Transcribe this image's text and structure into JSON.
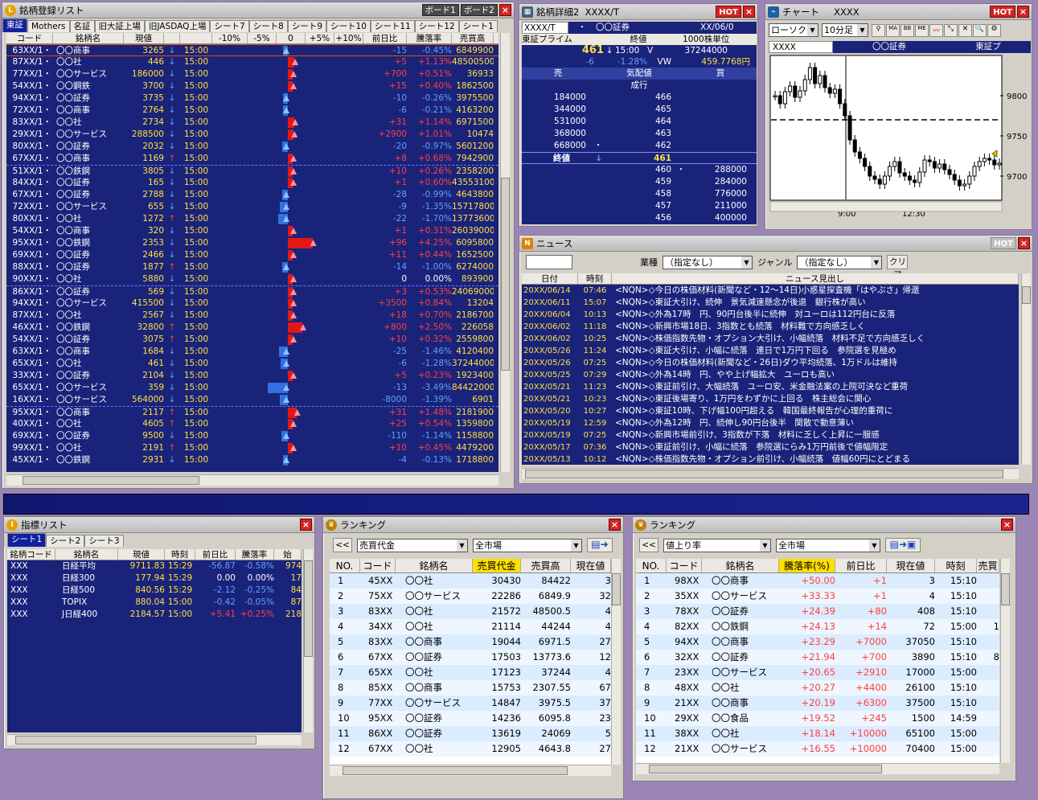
{
  "stocklist": {
    "title": "銘柄登録リスト",
    "board1": "ボード1",
    "board2": "ボード2",
    "tabs": [
      "東証",
      "Mothers",
      "名証",
      "旧大証上場",
      "旧JASDAQ上場",
      "シート7",
      "シート8",
      "シート9",
      "シート10",
      "シート11",
      "シート12",
      "シート1"
    ],
    "cols": [
      "コード",
      "銘柄名",
      "現値",
      "",
      "",
      "-10%",
      "-5%",
      "0",
      "+5%",
      "+10%",
      "前日比",
      "騰落率",
      "売買高"
    ],
    "rows": [
      [
        "63XX/1・",
        "〇〇商事",
        "3265",
        "↓",
        "15:00",
        "-15",
        "-0.45%",
        "6849900",
        -0.45
      ],
      [
        "87XX/1・",
        "〇〇社",
        "446",
        "↓",
        "15:00",
        "+5",
        "+1.13%",
        "48500500",
        1.13
      ],
      [
        "77XX/1・",
        "〇〇サービス",
        "186000",
        "↓",
        "15:00",
        "+700",
        "+0.51%",
        "36933",
        0.51
      ],
      [
        "54XX/1・",
        "〇〇鋼鉄",
        "3700",
        "↓",
        "15:00",
        "+15",
        "+0.40%",
        "1862500",
        0.4
      ],
      [
        "94XX/1・",
        "〇〇証券",
        "3735",
        "↓",
        "15:00",
        "-10",
        "-0.26%",
        "3975500",
        -0.26
      ],
      [
        "72XX/1・",
        "〇〇商事",
        "2764",
        "↓",
        "15:00",
        "-6",
        "-0.21%",
        "4163200",
        -0.21
      ],
      [
        "83XX/1・",
        "〇〇社",
        "2734",
        "↓",
        "15:00",
        "+31",
        "+1.14%",
        "6971500",
        1.14
      ],
      [
        "29XX/1・",
        "〇〇サービス",
        "288500",
        "↓",
        "15:00",
        "+2900",
        "+1.01%",
        "10474",
        1.01
      ],
      [
        "80XX/1・",
        "〇〇証券",
        "2032",
        "↓",
        "15:00",
        "-20",
        "-0.97%",
        "5601200",
        -0.97
      ],
      [
        "67XX/1・",
        "〇〇商事",
        "1169",
        "↑",
        "15:00",
        "+8",
        "+0.68%",
        "7942900",
        0.68
      ],
      [
        "51XX/1・",
        "〇〇鉄鋼",
        "3805",
        "↓",
        "15:00",
        "+10",
        "+0.26%",
        "2358200",
        0.26
      ],
      [
        "84XX/1・",
        "〇〇証券",
        "165",
        "↓",
        "15:00",
        "+1",
        "+0.60%",
        "43553100",
        0.6
      ],
      [
        "67XX/1・",
        "〇〇証券",
        "2788",
        "↓",
        "15:00",
        "-28",
        "-0.99%",
        "4643800",
        -0.99
      ],
      [
        "72XX/1・",
        "〇〇サービス",
        "655",
        "↓",
        "15:00",
        "-9",
        "-1.35%",
        "15717800",
        -1.35
      ],
      [
        "80XX/1・",
        "〇〇社",
        "1272",
        "↑",
        "15:00",
        "-22",
        "-1.70%",
        "13773600",
        -1.7
      ],
      [
        "54XX/1・",
        "〇〇商事",
        "320",
        "↓",
        "15:00",
        "+1",
        "+0.31%",
        "26039000",
        0.31
      ],
      [
        "95XX/1・",
        "〇〇鉄鋼",
        "2353",
        "↓",
        "15:00",
        "+96",
        "+4.25%",
        "6095800",
        4.25
      ],
      [
        "69XX/1・",
        "〇〇証券",
        "2466",
        "↓",
        "15:00",
        "+11",
        "+0.44%",
        "1652500",
        0.44
      ],
      [
        "88XX/1・",
        "〇〇証券",
        "1877",
        "↑",
        "15:00",
        "-14",
        "-1.00%",
        "6274000",
        -1.0
      ],
      [
        "90XX/1・",
        "〇〇社",
        "5880",
        "↓",
        "15:00",
        "0",
        "0.00%",
        "893900",
        0
      ],
      [
        "86XX/1・",
        "〇〇証券",
        "569",
        "↓",
        "15:00",
        "+3",
        "+0.53%",
        "24069000",
        0.53
      ],
      [
        "94XX/1・",
        "〇〇サービス",
        "415500",
        "↓",
        "15:00",
        "+3500",
        "+0.84%",
        "13204",
        0.84
      ],
      [
        "87XX/1・",
        "〇〇社",
        "2567",
        "↓",
        "15:00",
        "+18",
        "+0.70%",
        "2186700",
        0.7
      ],
      [
        "46XX/1・",
        "〇〇鉄鋼",
        "32800",
        "↑",
        "15:00",
        "+800",
        "+2.50%",
        "226058",
        2.5
      ],
      [
        "54XX/1・",
        "〇〇証券",
        "3075",
        "↑",
        "15:00",
        "+10",
        "+0.32%",
        "2559800",
        0.32
      ],
      [
        "63XX/1・",
        "〇〇商事",
        "1684",
        "↓",
        "15:00",
        "-25",
        "-1.46%",
        "4120400",
        -1.46
      ],
      [
        "65XX/1・",
        "〇〇社",
        "461",
        "↓",
        "15:00",
        "-6",
        "-1.28%",
        "37244000",
        -1.28
      ],
      [
        "33XX/1・",
        "〇〇証券",
        "2104",
        "↓",
        "15:00",
        "+5",
        "+0.23%",
        "1923400",
        0.23
      ],
      [
        "65XX/1・",
        "〇〇サービス",
        "359",
        "↓",
        "15:00",
        "-13",
        "-3.49%",
        "84422000",
        -3.49
      ],
      [
        "16XX/1・",
        "〇〇サービス",
        "564000",
        "↓",
        "15:00",
        "-8000",
        "-1.39%",
        "6901",
        -1.39
      ],
      [
        "95XX/1・",
        "〇〇商事",
        "2117",
        "↑",
        "15:00",
        "+31",
        "+1.48%",
        "2181900",
        1.48
      ],
      [
        "40XX/1・",
        "〇〇社",
        "4605",
        "↑",
        "15:00",
        "+25",
        "+0.54%",
        "1359800",
        0.54
      ],
      [
        "69XX/1・",
        "〇〇証券",
        "9500",
        "↓",
        "15:00",
        "-110",
        "-1.14%",
        "1158800",
        -1.14
      ],
      [
        "99XX/1・",
        "〇〇社",
        "2191",
        "↑",
        "15:00",
        "+10",
        "+0.45%",
        "4479200",
        0.45
      ],
      [
        "45XX/1・",
        "〇〇鉄鋼",
        "2931",
        "↓",
        "15:00",
        "-4",
        "-0.13%",
        "1718800",
        -0.13
      ]
    ]
  },
  "detail": {
    "title": "銘柄詳細2",
    "code": "XXXX/T",
    "row1": [
      "XXXX/T",
      "・",
      "〇〇証券",
      "XX/06/0"
    ],
    "market": "東証プライム",
    "close_label": "終値",
    "unit": "1000株単位",
    "price": "461",
    "arrow": "↓",
    "time": "15:00",
    "v_label": "V",
    "volume": "37244000",
    "change": "-6",
    "pct": "-1.28%",
    "vw_label": "VW",
    "vw": "459.7768円",
    "book_hdr": [
      "売",
      "気配値",
      "買"
    ],
    "market_order": "成行",
    "sells": [
      [
        "184000",
        "466"
      ],
      [
        "344000",
        "465"
      ],
      [
        "531000",
        "464"
      ],
      [
        "368000",
        "463"
      ],
      [
        "668000",
        "・",
        "462"
      ]
    ],
    "last": [
      "終値",
      "↓",
      "461"
    ],
    "buys": [
      [
        "460",
        "・",
        "288000"
      ],
      [
        "459",
        "284000"
      ],
      [
        "458",
        "776000"
      ],
      [
        "457",
        "211000"
      ],
      [
        "456",
        "400000"
      ]
    ]
  },
  "chart": {
    "title": "チャート",
    "code": "XXXX",
    "type": "ローソク",
    "interval": "10分足",
    "info": [
      "XXXX",
      "〇〇証券",
      "東証プ"
    ],
    "yticks": [
      "9800",
      "9750",
      "9700"
    ],
    "xticks": [
      "9:00",
      "12:30"
    ],
    "chart_data": {
      "type": "candlestick",
      "x": [
        "9:00",
        "12:30"
      ],
      "ylim": [
        9670,
        9850
      ],
      "yticks": [
        9800,
        9750,
        9700
      ]
    }
  },
  "news": {
    "title": "ニュース",
    "industry_label": "業種",
    "industry": "（指定なし）",
    "genre_label": "ジャンル",
    "genre": "（指定なし）",
    "clear": "クリア",
    "cols": [
      "日付",
      "時刻",
      "ニュース見出し"
    ],
    "rows": [
      [
        "20XX/06/14",
        "07:46",
        "<NQN>◇今日の株価材料(新聞など・12～14日)小惑星探査機「はやぶさ」帰還"
      ],
      [
        "20XX/06/11",
        "15:07",
        "<NQN>◇東証大引け、続伸　景気減速懸念が後退　銀行株が高い"
      ],
      [
        "20XX/06/04",
        "10:13",
        "<NQN>◇外為17時　円、90円台後半に続伸　対ユーロは112円台に反落"
      ],
      [
        "20XX/06/02",
        "11:18",
        "<NQN>◇新興市場18日、3指数とも続落　材料難で方向感乏しく"
      ],
      [
        "20XX/06/02",
        "10:25",
        "<NQN>◇株価指数先物・オプション大引け、小幅続落　材料不足で方向感乏しく"
      ],
      [
        "20XX/05/26",
        "11:24",
        "<NQN>◇東証大引け、小幅に続落　連日で1万円下回る　参院選を見極め"
      ],
      [
        "20XX/05/26",
        "07:25",
        "<NQN>◇今日の株価材料(新聞など・26日)ダウ平均続落、1万ドルは維持"
      ],
      [
        "20XX/05/25",
        "07:29",
        "<NQN>◇外為14時　円、やや上げ幅拡大　ユーロも高い"
      ],
      [
        "20XX/05/21",
        "11:23",
        "<NQN>◇東証前引け、大幅続落　ユーロ安、米金融法案の上院可決など重荷"
      ],
      [
        "20XX/05/21",
        "10:23",
        "<NQN>◇東証後場寄り、1万円をわずかに上回る　株主総会に関心"
      ],
      [
        "20XX/05/20",
        "10:27",
        "<NQN>◇東証10時、下げ幅100円超える　韓国最終報告が心理的重荷に"
      ],
      [
        "20XX/05/19",
        "12:59",
        "<NQN>◇外為12時　円、続伸し90円台後半　関散で動意薄い"
      ],
      [
        "20XX/05/19",
        "07:25",
        "<NQN>◇新興市場前引け、3指数が下落　材料に乏しく上昇に一服感"
      ],
      [
        "20XX/05/17",
        "07:36",
        "<NQN>◇東証前引け、小幅に続落　参院選にらみ1万円前後で値幅限定"
      ],
      [
        "20XX/05/13",
        "10:12",
        "<NQN>◇株価指数先物・オプション前引け、小幅続落　値幅60円にとどまる"
      ]
    ]
  },
  "indices": {
    "title": "指標リスト",
    "tabs": [
      "シート1",
      "シート2",
      "シート3"
    ],
    "cols": [
      "銘柄コード",
      "銘柄名",
      "現値",
      "時刻",
      "前日比",
      "騰落率",
      "始"
    ],
    "rows": [
      [
        "XXX",
        "日経平均",
        "9711.83",
        "15:29",
        "-56.87",
        "-0.58%",
        "974"
      ],
      [
        "XXX",
        "日経300",
        "177.94",
        "15:29",
        "0.00",
        "0.00%",
        "17"
      ],
      [
        "XXX",
        "日経500",
        "840.56",
        "15:29",
        "-2.12",
        "-0.25%",
        "84"
      ],
      [
        "XXX",
        "TOPIX",
        "880.04",
        "15:00",
        "-0.42",
        "-0.05%",
        "87"
      ],
      [
        "XXX",
        "J日経400",
        "2184.57",
        "15:00",
        "+5.41",
        "+0.25%",
        "218"
      ]
    ]
  },
  "rank1": {
    "title": "ランキング",
    "back": "<<",
    "metric": "売買代金",
    "market": "全市場",
    "cols": [
      "NO.",
      "コード",
      "銘柄名",
      "売買代金",
      "売買高",
      "現在値"
    ],
    "rows": [
      [
        "1",
        "45XX",
        "〇〇社",
        "30430",
        "84422",
        "3"
      ],
      [
        "2",
        "75XX",
        "〇〇サービス",
        "22286",
        "6849.9",
        "32"
      ],
      [
        "3",
        "83XX",
        "〇〇社",
        "21572",
        "48500.5",
        "4"
      ],
      [
        "4",
        "34XX",
        "〇〇社",
        "21114",
        "44244",
        "4"
      ],
      [
        "5",
        "83XX",
        "〇〇商事",
        "19044",
        "6971.5",
        "27"
      ],
      [
        "6",
        "67XX",
        "〇〇証券",
        "17503",
        "13773.6",
        "12"
      ],
      [
        "7",
        "65XX",
        "〇〇社",
        "17123",
        "37244",
        "4"
      ],
      [
        "8",
        "85XX",
        "〇〇商事",
        "15753",
        "2307.55",
        "67"
      ],
      [
        "9",
        "77XX",
        "〇〇サービス",
        "14847",
        "3975.5",
        "37"
      ],
      [
        "10",
        "95XX",
        "〇〇証券",
        "14236",
        "6095.8",
        "23"
      ],
      [
        "11",
        "86XX",
        "〇〇証券",
        "13619",
        "24069",
        "5"
      ],
      [
        "12",
        "67XX",
        "〇〇社",
        "12905",
        "4643.8",
        "27"
      ]
    ]
  },
  "rank2": {
    "title": "ランキング",
    "back": "<<",
    "metric": "値上り率",
    "market": "全市場",
    "cols": [
      "NO.",
      "コード",
      "銘柄名",
      "騰落率(%)",
      "前日比",
      "現在値",
      "時刻",
      "売買"
    ],
    "rows": [
      [
        "1",
        "98XX",
        "〇〇商事",
        "+50.00",
        "+1",
        "3",
        "15:10",
        ""
      ],
      [
        "2",
        "35XX",
        "〇〇サービス",
        "+33.33",
        "+1",
        "4",
        "15:10",
        ""
      ],
      [
        "3",
        "78XX",
        "〇〇証券",
        "+24.39",
        "+80",
        "408",
        "15:10",
        ""
      ],
      [
        "4",
        "82XX",
        "〇〇鉄鋼",
        "+24.13",
        "+14",
        "72",
        "15:00",
        "1"
      ],
      [
        "5",
        "94XX",
        "〇〇商事",
        "+23.29",
        "+7000",
        "37050",
        "15:10",
        ""
      ],
      [
        "6",
        "32XX",
        "〇〇証券",
        "+21.94",
        "+700",
        "3890",
        "15:10",
        "8"
      ],
      [
        "7",
        "23XX",
        "〇〇サービス",
        "+20.65",
        "+2910",
        "17000",
        "15:00",
        ""
      ],
      [
        "8",
        "48XX",
        "〇〇社",
        "+20.27",
        "+4400",
        "26100",
        "15:10",
        ""
      ],
      [
        "9",
        "21XX",
        "〇〇商事",
        "+20.19",
        "+6300",
        "37500",
        "15:10",
        ""
      ],
      [
        "10",
        "29XX",
        "〇〇食品",
        "+19.52",
        "+245",
        "1500",
        "14:59",
        ""
      ],
      [
        "11",
        "38XX",
        "〇〇社",
        "+18.14",
        "+10000",
        "65100",
        "15:00",
        ""
      ],
      [
        "12",
        "21XX",
        "〇〇サービス",
        "+16.55",
        "+10000",
        "70400",
        "15:00",
        ""
      ]
    ]
  }
}
